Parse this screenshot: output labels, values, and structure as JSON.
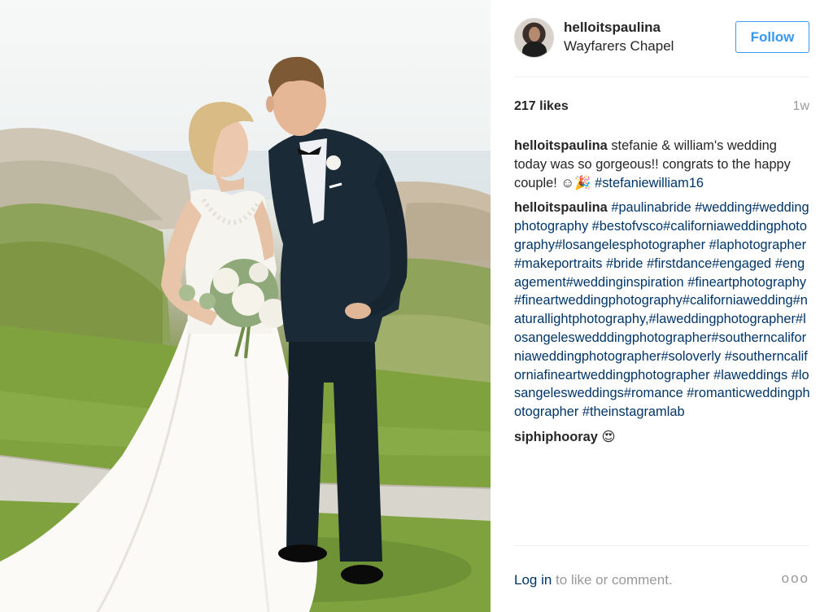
{
  "photo": {
    "alt_subject": "wedding-couple-photo"
  },
  "header": {
    "username": "helloitspaulina",
    "location": "Wayfarers Chapel",
    "follow_label": "Follow"
  },
  "stats": {
    "likes": "217 likes",
    "time_ago": "1w"
  },
  "comments": [
    {
      "user": "helloitspaulina",
      "text": "stefanie & william's wedding today was so gorgeous!! congrats to the happy couple! ☺🎉",
      "tag": "#stefaniewilliam16"
    },
    {
      "user": "helloitspaulina",
      "tags": "#paulinabride #wedding#weddingphotography #bestofvsco#californiaweddingphotography#losangelesphotographer #laphotographer#makeportraits #bride #firstdance#engaged #engagement#weddinginspiration #fineartphotography#fineartweddingphotography#californiawedding#naturallightphotography,#laweddingphotographer#losangeleswedddingphotographer#southerncaliforniaweddingphotographer#soloverly #southerncaliforniafineartweddingphotographer #laweddings #losangelesweddings#romance #romanticweddingphotographer #theinstagramlab"
    },
    {
      "user": "siphiphooray",
      "text": "😍"
    }
  ],
  "footer": {
    "login_link": "Log in",
    "login_rest": " to like or comment.",
    "more_label": "ooo"
  },
  "colors": {
    "link": "#003569",
    "follow_blue": "#3897f0",
    "muted": "#999999",
    "text": "#262626"
  }
}
